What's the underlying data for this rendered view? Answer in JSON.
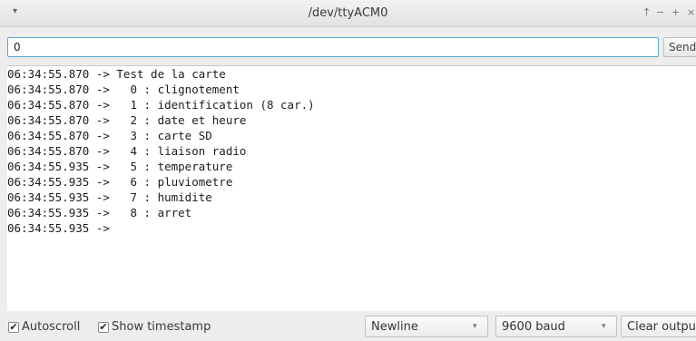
{
  "window": {
    "title": "/dev/ttyACM0",
    "menu_glyph": "▾",
    "controls": {
      "up": "↑",
      "minimize": "−",
      "maximize": "+",
      "close": "×"
    }
  },
  "input": {
    "value": "0",
    "send_label": "Send"
  },
  "console": {
    "lines": [
      "06:34:55.870 -> Test de la carte",
      "06:34:55.870 ->   0 : clignotement",
      "06:34:55.870 ->   1 : identification (8 car.)",
      "06:34:55.870 ->   2 : date et heure",
      "06:34:55.870 ->   3 : carte SD",
      "06:34:55.870 ->   4 : liaison radio",
      "06:34:55.935 ->   5 : temperature",
      "06:34:55.935 ->   6 : pluviometre",
      "06:34:55.935 ->   7 : humidite",
      "06:34:55.935 ->   8 : arret",
      "06:34:55.935 ->"
    ]
  },
  "footer": {
    "autoscroll": {
      "label": "Autoscroll",
      "checked": true
    },
    "timestamp": {
      "label": "Show timestamp",
      "checked": true
    },
    "line_ending": {
      "selected": "Newline"
    },
    "baud": {
      "selected": "9600 baud"
    },
    "clear_label": "Clear output",
    "check_glyph": "✔",
    "arrow_glyph": "▾"
  }
}
